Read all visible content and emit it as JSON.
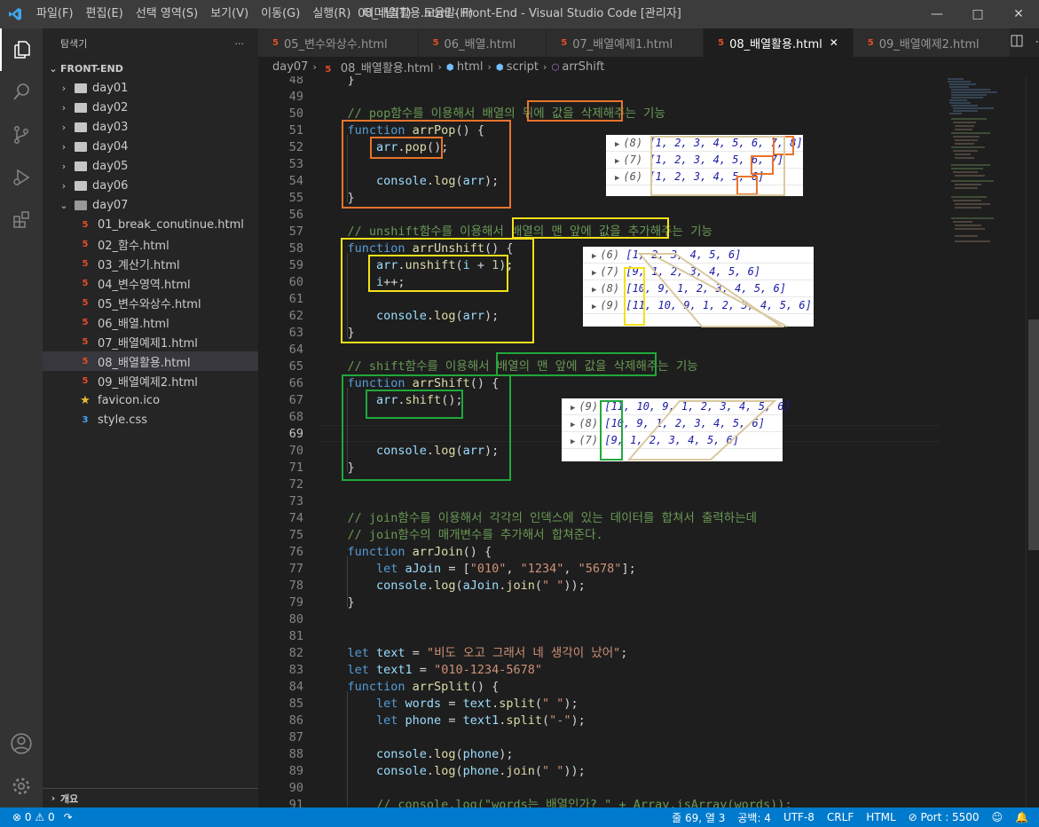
{
  "window": {
    "title": "08_배열활용.html - Front-End - Visual Studio Code [관리자]"
  },
  "menu": [
    "파일(F)",
    "편집(E)",
    "선택 영역(S)",
    "보기(V)",
    "이동(G)",
    "실행(R)",
    "터미널(T)",
    "도움말(H)"
  ],
  "explorer": {
    "title": "탐색기",
    "root": "FRONT-END",
    "outline": "개요",
    "folders": [
      "day01",
      "day02",
      "day03",
      "day04",
      "day05",
      "day06"
    ],
    "open_folder": "day07",
    "files": [
      "01_break_conutinue.html",
      "02_함수.html",
      "03_계산기.html",
      "04_변수영역.html",
      "05_변수와상수.html",
      "06_배열.html",
      "07_배열예제1.html",
      "08_배열활용.html",
      "09_배열예제2.html"
    ],
    "favicon": "favicon.ico",
    "style": "style.css"
  },
  "tabs": [
    "05_변수와상수.html",
    "06_배열.html",
    "07_배열예제1.html",
    "08_배열활용.html",
    "09_배열예제2.html"
  ],
  "breadcrumb": [
    "day07",
    "08_배열활용.html",
    "html",
    "script",
    "arrShift"
  ],
  "consoles": {
    "pop": [
      {
        "len": "(8)",
        "arr": "[1, 2, 3, 4, 5, 6, 7, 8]"
      },
      {
        "len": "(7)",
        "arr": "[1, 2, 3, 4, 5, 6, 7]"
      },
      {
        "len": "(6)",
        "arr": "[1, 2, 3, 4, 5, 6]"
      }
    ],
    "unshift": [
      {
        "len": "(6)",
        "arr": "[1, 2, 3, 4, 5, 6]"
      },
      {
        "len": "(7)",
        "arr": "[9, 1, 2, 3, 4, 5, 6]"
      },
      {
        "len": "(8)",
        "arr": "[10, 9, 1, 2, 3, 4, 5, 6]"
      },
      {
        "len": "(9)",
        "arr": "[11, 10, 9, 1, 2, 3, 4, 5, 6]"
      }
    ],
    "shift": [
      {
        "len": "(9)",
        "arr": "[11, 10, 9, 1, 2, 3, 4, 5, 6]"
      },
      {
        "len": "(8)",
        "arr": "[10, 9, 1, 2, 3, 4, 5, 6]"
      },
      {
        "len": "(7)",
        "arr": "[9, 1, 2, 3, 4, 5, 6]"
      }
    ]
  },
  "status": {
    "errors": "0",
    "warnings": "0",
    "position": "줄 69, 열 3",
    "spaces": "공백: 4",
    "encoding": "UTF-8",
    "eol": "CRLF",
    "language": "HTML",
    "port": "Port : 5500"
  },
  "colors": {
    "accent": "#007acc",
    "orange": "#e8742c",
    "yellow": "#f5e11a",
    "green": "#1fa93a",
    "tan": "#d9c9a0"
  }
}
